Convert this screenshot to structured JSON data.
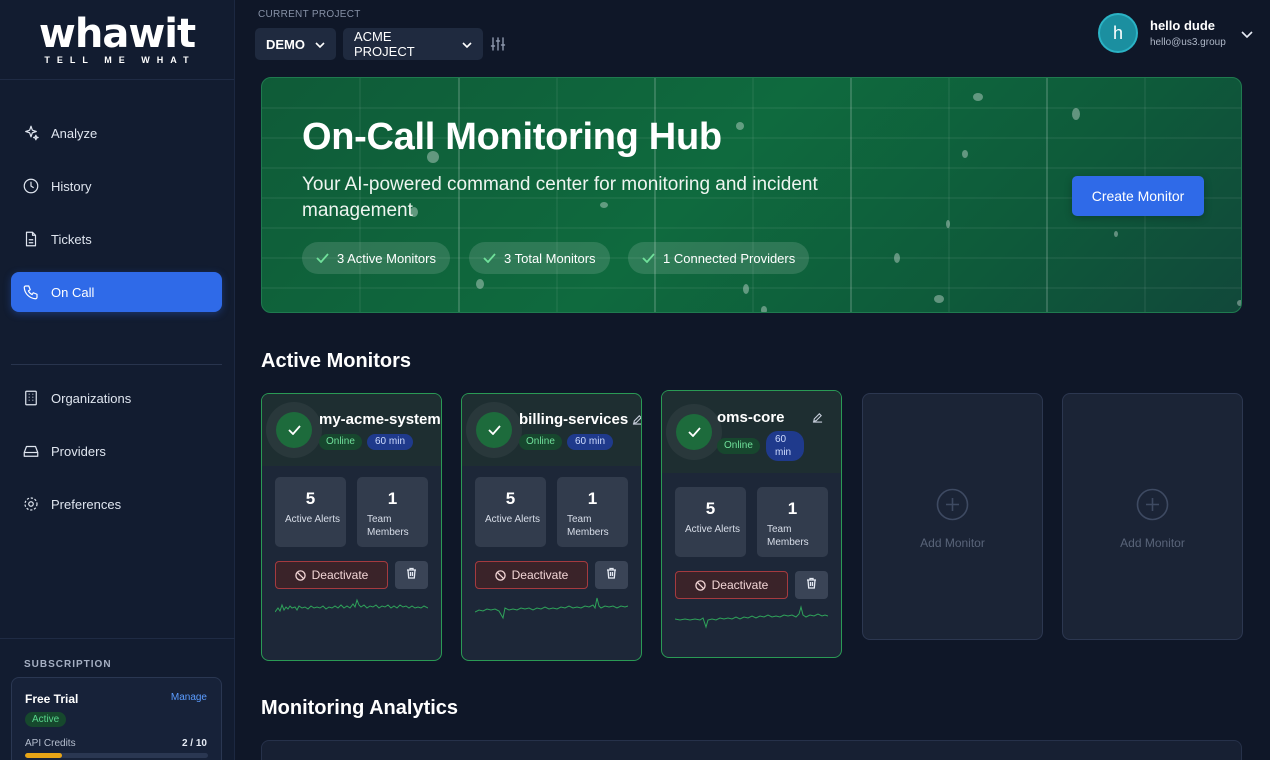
{
  "brand": {
    "name": "whawit",
    "tagline": "TELL ME WHAT"
  },
  "sidebar": {
    "nav_top": [
      {
        "label": "Analyze",
        "icon": "sparkle-icon"
      },
      {
        "label": "History",
        "icon": "clock-icon"
      },
      {
        "label": "Tickets",
        "icon": "document-icon"
      },
      {
        "label": "On Call",
        "icon": "phone-icon",
        "active": true
      }
    ],
    "nav_bottom": [
      {
        "label": "Organizations",
        "icon": "building-icon"
      },
      {
        "label": "Providers",
        "icon": "drive-icon"
      },
      {
        "label": "Preferences",
        "icon": "gear-icon"
      }
    ],
    "subscription": {
      "title": "SUBSCRIPTION",
      "plan": "Free Trial",
      "manage": "Manage",
      "status": "Active",
      "credits_label": "API Credits",
      "credits_value": "2 / 10",
      "credits_fraction": 0.2
    }
  },
  "header": {
    "project_label": "CURRENT PROJECT",
    "org_select": "DEMO",
    "project_select": "ACME PROJECT",
    "user": {
      "initial": "h",
      "name": "hello dude",
      "email": "hello@us3.group"
    }
  },
  "hero": {
    "title": "On-Call Monitoring Hub",
    "subtitle": "Your AI-powered command center for monitoring and incident management",
    "pills": [
      "3 Active Monitors",
      "3 Total Monitors",
      "1 Connected Providers"
    ],
    "create_button": "Create Monitor"
  },
  "sections": {
    "active_monitors": "Active Monitors",
    "analytics": "Monitoring Analytics"
  },
  "monitors": [
    {
      "name": "my-acme-system",
      "status": "Online",
      "interval": "60 min",
      "alerts": "5",
      "alerts_label": "Active Alerts",
      "members": "1",
      "members_label": "Team Members",
      "deactivate": "Deactivate"
    },
    {
      "name": "billing-services",
      "status": "Online",
      "interval": "60 min",
      "alerts": "5",
      "alerts_label": "Active Alerts",
      "members": "1",
      "members_label": "Team Members",
      "deactivate": "Deactivate"
    },
    {
      "name": "oms-core",
      "status": "Online",
      "interval": "60 min",
      "alerts": "5",
      "alerts_label": "Active Alerts",
      "members": "1",
      "members_label": "Team Members",
      "deactivate": "Deactivate"
    }
  ],
  "add_monitor": {
    "label": "Add Monitor"
  },
  "colors": {
    "accent": "#2f6ae8",
    "success": "#2a9a55",
    "danger": "#a53a3f",
    "credits": "#e8a516"
  }
}
